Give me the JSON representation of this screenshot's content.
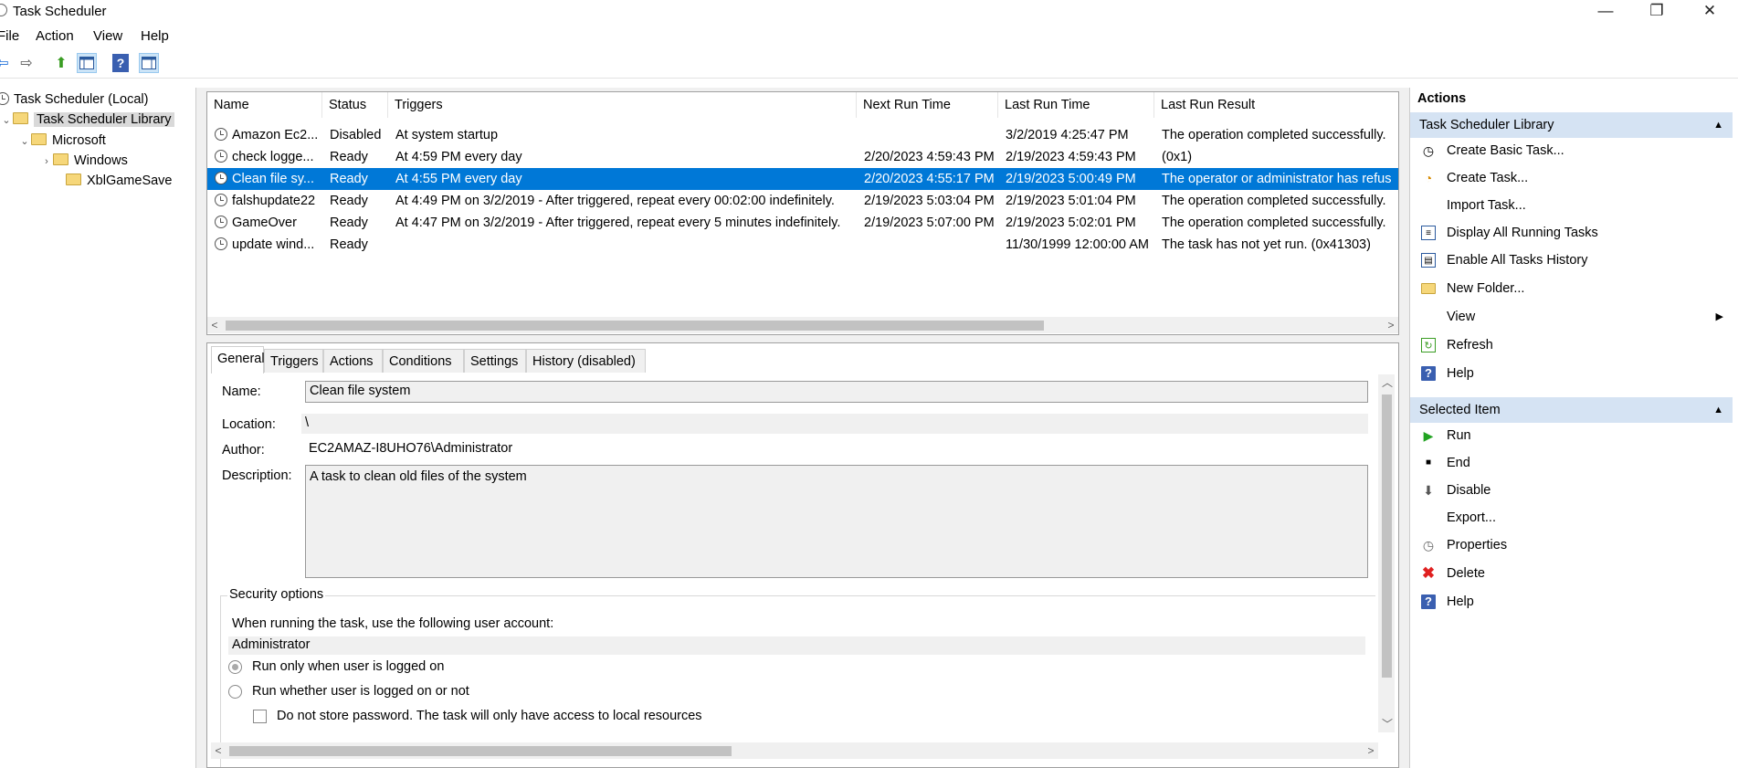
{
  "window": {
    "title": "Task Scheduler",
    "minimize": "—",
    "restore": "❐",
    "close": "✕"
  },
  "menu": [
    "File",
    "Action",
    "View",
    "Help"
  ],
  "toolbar": {
    "back": "⇦",
    "forward": "⇨",
    "up": "⬆",
    "help": "?"
  },
  "tree": {
    "root": "Task Scheduler (Local)",
    "library": "Task Scheduler Library",
    "microsoft": "Microsoft",
    "windows": "Windows",
    "xbl": "XblGameSave"
  },
  "list": {
    "columns": [
      "Name",
      "Status",
      "Triggers",
      "Next Run Time",
      "Last Run Time",
      "Last Run Result"
    ],
    "rows": [
      {
        "name": "Amazon Ec2...",
        "status": "Disabled",
        "triggers": "At system startup",
        "next": "",
        "last": "3/2/2019 4:25:47 PM",
        "result": "The operation completed successfully."
      },
      {
        "name": "check logge...",
        "status": "Ready",
        "triggers": "At 4:59 PM every day",
        "next": "2/20/2023 4:59:43 PM",
        "last": "2/19/2023 4:59:43 PM",
        "result": "(0x1)"
      },
      {
        "name": "Clean file sy...",
        "status": "Ready",
        "triggers": "At 4:55 PM every day",
        "next": "2/20/2023 4:55:17 PM",
        "last": "2/19/2023 5:00:49 PM",
        "result": "The operator or administrator has refus"
      },
      {
        "name": "falshupdate22",
        "status": "Ready",
        "triggers": "At 4:49 PM on 3/2/2019 - After triggered, repeat every 00:02:00 indefinitely.",
        "next": "2/19/2023 5:03:04 PM",
        "last": "2/19/2023 5:01:04 PM",
        "result": "The operation completed successfully."
      },
      {
        "name": "GameOver",
        "status": "Ready",
        "triggers": "At 4:47 PM on 3/2/2019 - After triggered, repeat every 5 minutes indefinitely.",
        "next": "2/19/2023 5:07:00 PM",
        "last": "2/19/2023 5:02:01 PM",
        "result": "The operation completed successfully."
      },
      {
        "name": "update wind...",
        "status": "Ready",
        "triggers": "",
        "next": "",
        "last": "11/30/1999 12:00:00 AM",
        "result": "The task has not yet run. (0x41303)"
      }
    ]
  },
  "detail": {
    "tabs": [
      "General",
      "Triggers",
      "Actions",
      "Conditions",
      "Settings",
      "History (disabled)"
    ],
    "name_label": "Name:",
    "name_value": "Clean file system",
    "location_label": "Location:",
    "location_value": "\\",
    "author_label": "Author:",
    "author_value": "EC2AMAZ-I8UHO76\\Administrator",
    "description_label": "Description:",
    "description_value": "A task to clean old files of the system",
    "security_title": "Security options",
    "security_account_text": "When running the task, use the following user account:",
    "security_account": "Administrator",
    "radio_logged_on": "Run only when user is logged on",
    "radio_whether": "Run whether user is logged on or not",
    "check_no_store": "Do not store password.  The task will only have access to local resources"
  },
  "actions": {
    "title": "Actions",
    "section1": "Task Scheduler Library",
    "items1": [
      "Create Basic Task...",
      "Create Task...",
      "Import Task...",
      "Display All Running Tasks",
      "Enable All Tasks History",
      "New Folder...",
      "View",
      "Refresh",
      "Help"
    ],
    "section2": "Selected Item",
    "items2": [
      "Run",
      "End",
      "Disable",
      "Export...",
      "Properties",
      "Delete",
      "Help"
    ]
  },
  "colors": {
    "selection": "#0078d7",
    "section_header": "#d5e3f3"
  }
}
